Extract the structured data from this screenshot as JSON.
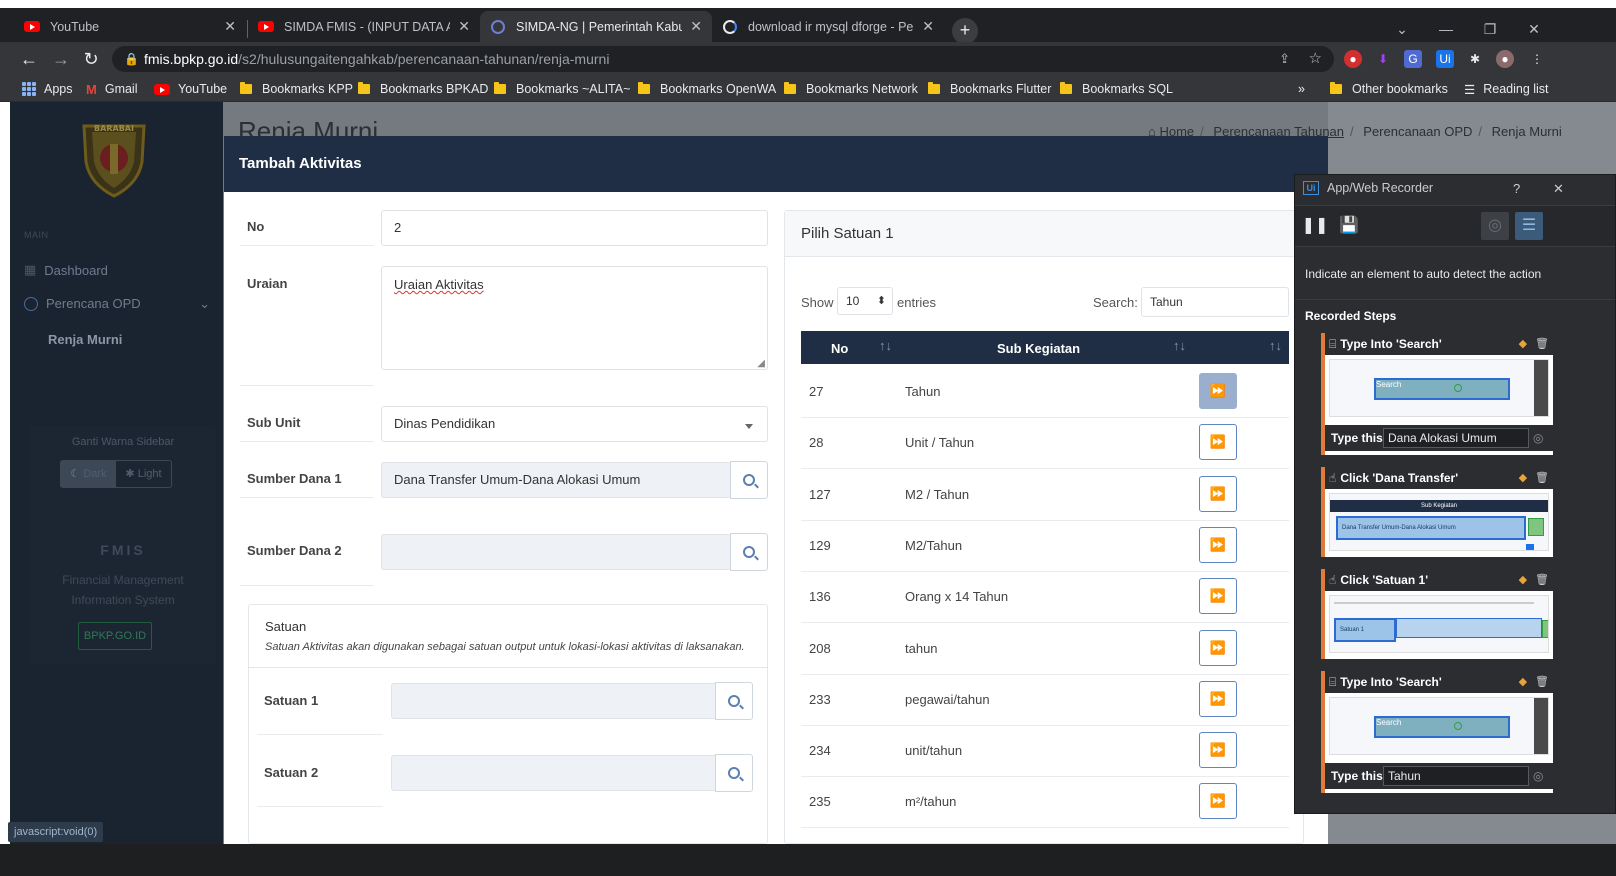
{
  "browser": {
    "tabs": [
      {
        "title": "YouTube",
        "icon": "youtube-icon",
        "active": false
      },
      {
        "title": "SIMDA FMIS - (INPUT DATA ANG",
        "icon": "youtube-icon",
        "active": false
      },
      {
        "title": "SIMDA-NG | Pemerintah Kabupat",
        "icon": "globe-icon",
        "active": true
      },
      {
        "title": "download ir mysql dforge - Pene",
        "icon": "google-icon",
        "active": false
      }
    ],
    "url_host": "fmis.bpkp.go.id",
    "url_path": "/s2/hulusungaitengahkab/perencanaan-tahunan/renja-murni",
    "bookmarks": [
      "Apps",
      "Gmail",
      "YouTube",
      "Bookmarks KPP",
      "Bookmarks BPKAD",
      "Bookmarks ~ALITA~",
      "Bookmarks OpenWA",
      "Bookmarks Network",
      "Bookmarks Flutter",
      "Bookmarks SQL"
    ],
    "other_bookmarks": "Other bookmarks",
    "reading_list": "Reading list",
    "overflow": "»"
  },
  "sidebar": {
    "section": "MAIN",
    "items": [
      {
        "label": "Dashboard"
      },
      {
        "label": "Perencana OPD"
      },
      {
        "label": "Renja Murni"
      }
    ],
    "color_title": "Ganti Warna Sidebar",
    "dark_label": "Dark",
    "light_label": "Light",
    "fmis_title": "FMIS",
    "fmis_sub1": "Financial Management",
    "fmis_sub2": "Information System",
    "site_button": "BPKP.GO.ID",
    "logo_text": "BARABAI"
  },
  "page": {
    "title": "Renja Murni",
    "breadcrumbs": [
      "Home",
      "Perencanaan Tahunan",
      "Perencanaan OPD",
      "Renja Murni"
    ],
    "status": "javascript:void(0)"
  },
  "modal": {
    "title": "Tambah Aktivitas",
    "close": "×",
    "fields": {
      "no_label": "No",
      "no_value": "2",
      "uraian_label": "Uraian",
      "uraian_value": "Uraian Aktivitas",
      "subunit_label": "Sub Unit",
      "subunit_value": "Dinas Pendidikan",
      "sd1_label": "Sumber Dana 1",
      "sd1_value": "Dana Transfer Umum-Dana Alokasi Umum",
      "sd2_label": "Sumber Dana 2",
      "sd2_value": ""
    },
    "satuan": {
      "title": "Satuan",
      "desc": "Satuan Aktivitas akan digunakan sebagai satuan output untuk lokasi-lokasi aktivitas di laksanakan.",
      "s1_label": "Satuan 1",
      "s2_label": "Satuan 2"
    },
    "picker": {
      "title": "Pilih Satuan 1",
      "show": "Show",
      "length": "10",
      "entries": "entries",
      "search_label": "Search:",
      "search_value": "Tahun",
      "col_no": "No",
      "col_sub": "Sub Kegiatan",
      "rows": [
        {
          "no": "27",
          "name": "Tahun"
        },
        {
          "no": "28",
          "name": "Unit / Tahun"
        },
        {
          "no": "127",
          "name": "M2 / Tahun"
        },
        {
          "no": "129",
          "name": "M2/Tahun"
        },
        {
          "no": "136",
          "name": "Orang x 14 Tahun"
        },
        {
          "no": "208",
          "name": "tahun"
        },
        {
          "no": "233",
          "name": "pegawai/tahun"
        },
        {
          "no": "234",
          "name": "unit/tahun"
        },
        {
          "no": "235",
          "name": "m²/tahun"
        }
      ]
    }
  },
  "recorder": {
    "title": "App/Web Recorder",
    "help": "?",
    "hint": "Indicate an element to auto detect the action",
    "steps_title": "Recorded Steps",
    "steps": [
      {
        "title": "Type Into 'Search'",
        "type_label": "Type this",
        "type_value": "Dana Alokasi Umum"
      },
      {
        "title": "Click 'Dana Transfer'"
      },
      {
        "title": "Click 'Satuan 1'"
      },
      {
        "title": "Type Into 'Search'",
        "type_label": "Type this",
        "type_value": "Tahun"
      }
    ],
    "thumb_search_label": "Search",
    "thumb_header": "Sub Kegiatan",
    "thumb_row": "Dana Transfer Umum-Dana Alokasi Umum",
    "thumb_satuan": "Satuan 1"
  },
  "colors": {
    "navy": "#1f2e44",
    "sidebar": "#1a2330",
    "accent_blue": "#5e86c1",
    "recorder_orange": "#e07b39"
  }
}
